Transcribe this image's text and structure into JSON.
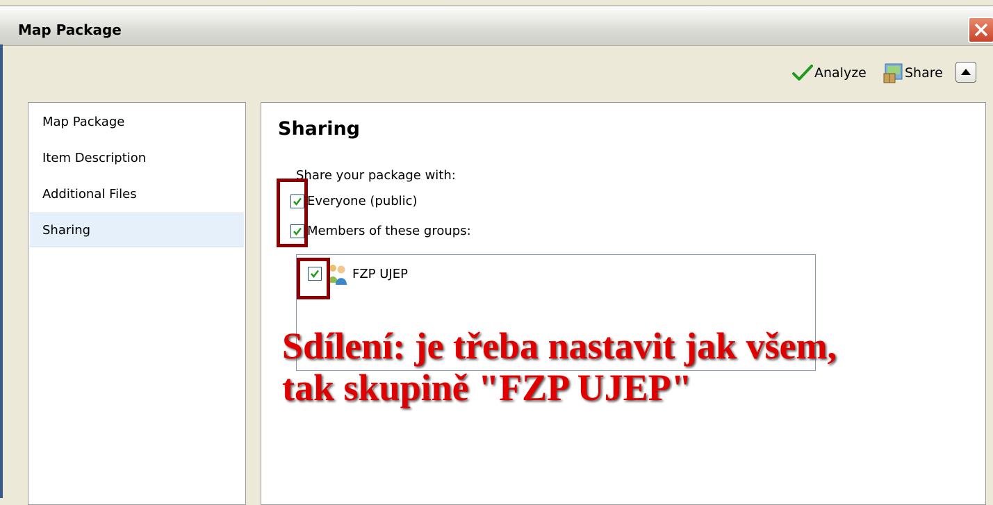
{
  "window": {
    "title": "Map Package"
  },
  "toolbar": {
    "analyze_label": "Analyze",
    "share_label": "Share"
  },
  "nav": {
    "items": [
      {
        "label": "Map Package"
      },
      {
        "label": "Item Description"
      },
      {
        "label": "Additional Files"
      },
      {
        "label": "Sharing"
      }
    ],
    "selected": "Sharing"
  },
  "main": {
    "heading": "Sharing",
    "share_with_label": "Share your package with:",
    "options": [
      {
        "label": "Everyone (public)",
        "checked": true
      },
      {
        "label": "Members of these groups:",
        "checked": true
      }
    ],
    "groups": [
      {
        "label": "FZP UJEP",
        "checked": true
      }
    ]
  },
  "annotation": {
    "line1": "Sdílení: je třeba nastavit jak všem,",
    "line2": "tak skupině \"FZP UJEP\""
  },
  "colors": {
    "accent_red": "#e00000",
    "highlight_dark_red": "#8b0000",
    "check_green": "#1f9a1f"
  }
}
